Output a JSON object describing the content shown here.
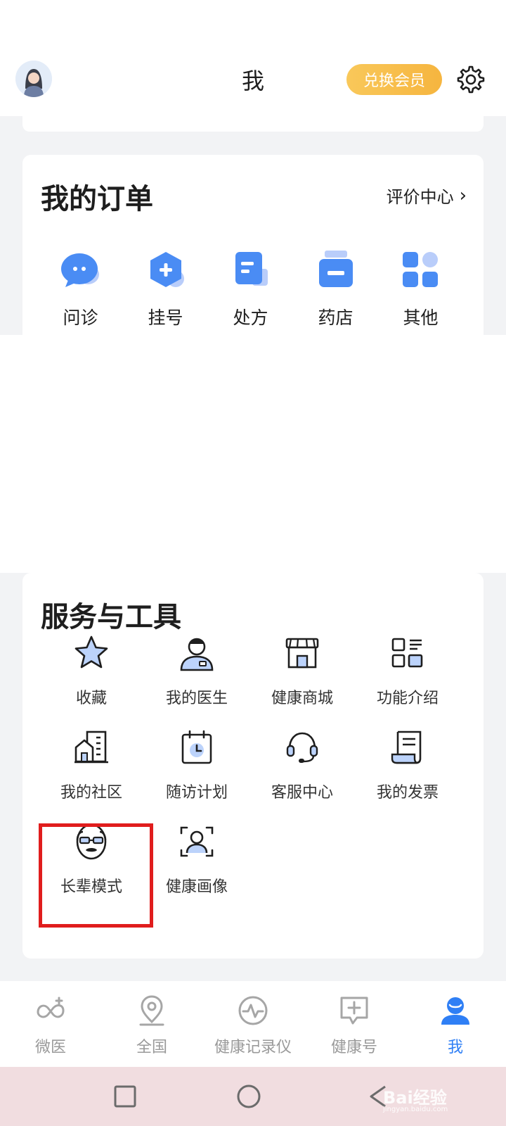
{
  "header": {
    "title": "我",
    "vip_button": "兑换会员"
  },
  "orders": {
    "title": "我的订单",
    "review_link": "评价中心",
    "items": [
      {
        "label": "问诊",
        "icon": "chat-bubble-icon"
      },
      {
        "label": "挂号",
        "icon": "registration-hexagon-icon"
      },
      {
        "label": "处方",
        "icon": "prescription-icon"
      },
      {
        "label": "药店",
        "icon": "pharmacy-jar-icon"
      },
      {
        "label": "其他",
        "icon": "grid-icon"
      }
    ]
  },
  "tools": {
    "title": "服务与工具",
    "items": [
      {
        "label": "收藏",
        "icon": "star-icon"
      },
      {
        "label": "我的医生",
        "icon": "doctor-icon"
      },
      {
        "label": "健康商城",
        "icon": "store-icon"
      },
      {
        "label": "功能介绍",
        "icon": "feature-list-icon"
      },
      {
        "label": "我的社区",
        "icon": "community-building-icon"
      },
      {
        "label": "随访计划",
        "icon": "calendar-clock-icon"
      },
      {
        "label": "客服中心",
        "icon": "headset-icon"
      },
      {
        "label": "我的发票",
        "icon": "invoice-icon"
      },
      {
        "label": "长辈模式",
        "icon": "elder-face-icon"
      },
      {
        "label": "健康画像",
        "icon": "face-scan-icon"
      }
    ]
  },
  "tabbar": {
    "items": [
      {
        "label": "微医",
        "icon": "weiyi-logo-icon",
        "active": false
      },
      {
        "label": "全国",
        "icon": "location-pin-icon",
        "active": false
      },
      {
        "label": "健康记录仪",
        "icon": "pulse-icon",
        "active": false
      },
      {
        "label": "健康号",
        "icon": "plus-message-icon",
        "active": false
      },
      {
        "label": "我",
        "icon": "profile-icon",
        "active": true
      }
    ]
  },
  "watermark": {
    "text": "Bai经验",
    "sub": "jingyan.baidu.com"
  },
  "colors": {
    "accent": "#2f7ff5",
    "vip": "#f6b53f",
    "highlight": "#e01d1d"
  }
}
